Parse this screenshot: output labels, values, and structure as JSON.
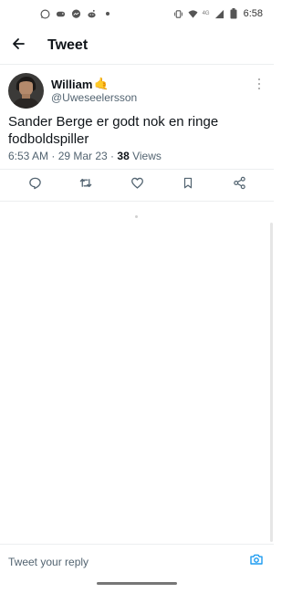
{
  "status_bar": {
    "time": "6:58",
    "network": "4G",
    "icons_left": [
      "whatsapp-icon",
      "game-icon",
      "messenger-icon",
      "reddit-icon",
      "dot-icon"
    ],
    "icons_right": [
      "vibrate-icon",
      "wifi-icon",
      "signal-icon",
      "battery-icon"
    ]
  },
  "header": {
    "title": "Tweet",
    "back_icon": "arrow-left-icon"
  },
  "tweet": {
    "author_name": "William",
    "author_emoji": "🤙",
    "author_handle": "@Uweseelersson",
    "text": "Sander Berge er godt nok en ringe fodboldspiller",
    "time": "6:53 AM · 29 Mar 23 · ",
    "views_count": "38",
    "views_label": " Views",
    "actions": [
      "reply-icon",
      "retweet-icon",
      "like-icon",
      "bookmark-icon",
      "share-icon"
    ]
  },
  "reply_bar": {
    "placeholder": "Tweet your reply",
    "camera_icon": "camera-icon"
  },
  "colors": {
    "accent": "#1d9bf0",
    "text": "#0f1419",
    "secondary": "#536471",
    "divider": "#eceef0"
  }
}
